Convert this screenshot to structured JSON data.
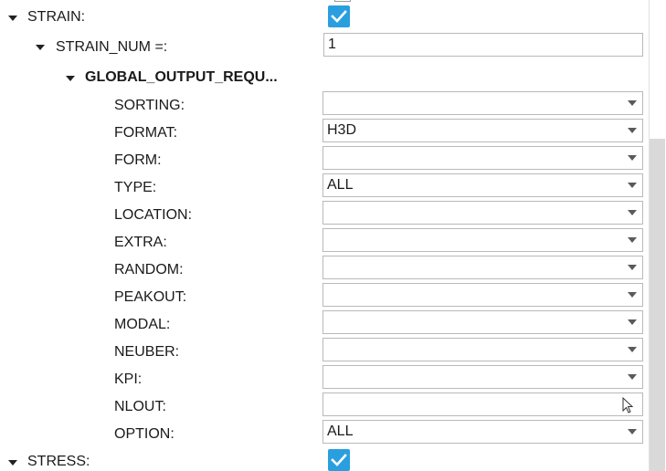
{
  "strain": {
    "label": "STRAIN:",
    "checked": true,
    "strain_num": {
      "label": "STRAIN_NUM =:",
      "value": "1"
    },
    "global_output_request": {
      "label": "GLOBAL_OUTPUT_REQU...",
      "fields": [
        {
          "label": "SORTING:",
          "value": "",
          "kind": "select"
        },
        {
          "label": "FORMAT:",
          "value": "H3D",
          "kind": "select"
        },
        {
          "label": "FORM:",
          "value": "",
          "kind": "select"
        },
        {
          "label": "TYPE:",
          "value": "ALL",
          "kind": "select"
        },
        {
          "label": "LOCATION:",
          "value": "",
          "kind": "select"
        },
        {
          "label": "EXTRA:",
          "value": "",
          "kind": "select"
        },
        {
          "label": "RANDOM:",
          "value": "",
          "kind": "select"
        },
        {
          "label": "PEAKOUT:",
          "value": "",
          "kind": "select"
        },
        {
          "label": "MODAL:",
          "value": "",
          "kind": "select"
        },
        {
          "label": "NEUBER:",
          "value": "",
          "kind": "select"
        },
        {
          "label": "KPI:",
          "value": "",
          "kind": "select"
        },
        {
          "label": "NLOUT:",
          "value": "",
          "kind": "text"
        },
        {
          "label": "OPTION:",
          "value": "ALL",
          "kind": "select"
        }
      ]
    }
  },
  "stress": {
    "label": "STRESS:",
    "checked": true
  },
  "icons": {
    "expand_toggle": "caret-down-icon",
    "dropdown_arrow": "chevron-down-icon",
    "checkbox_check": "checkmark-icon",
    "mouse_cursor": "mouse-pointer-icon"
  },
  "colors": {
    "checkbox_accent": "#2a9fe0",
    "scrollbar_thumb": "#d9d9d9"
  }
}
